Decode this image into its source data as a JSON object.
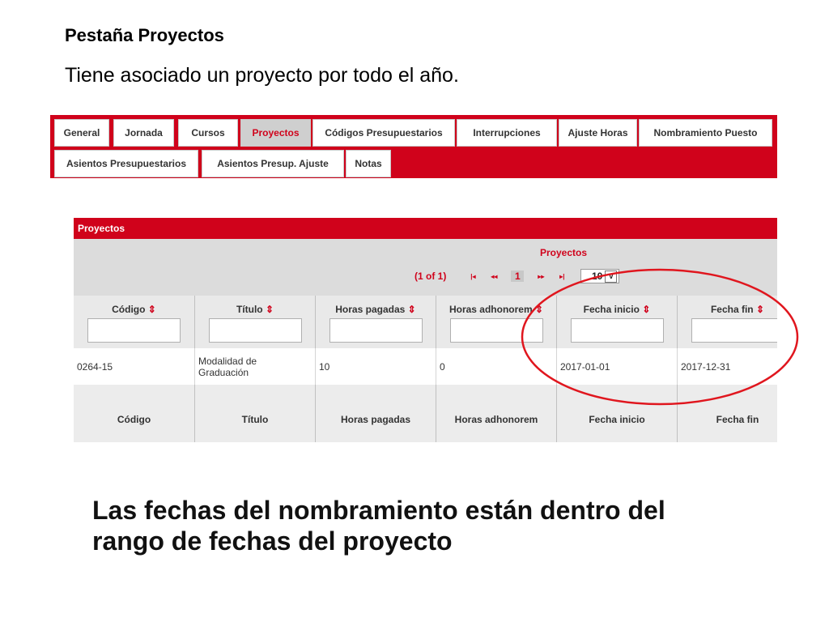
{
  "slide": {
    "heading": "Pestaña Proyectos",
    "intro": "Tiene asociado un proyecto por todo el año.",
    "conclusion": "Las fechas del nombramiento están dentro del rango de fechas del proyecto"
  },
  "tabs": {
    "general": "General",
    "jornada": "Jornada",
    "cursos": "Cursos",
    "proyectos": "Proyectos",
    "codigos": "Códigos Presupuestarios",
    "interrupciones": "Interrupciones",
    "ajuste_horas": "Ajuste Horas",
    "nombramiento": "Nombramiento Puesto",
    "asientos": "Asientos Presupuestarios",
    "asientos_ajuste": "Asientos Presup. Ajuste",
    "notas": "Notas",
    "active": "Proyectos"
  },
  "panel": {
    "title": "Proyectos",
    "caption": "Proyectos",
    "pager": {
      "count": "(1 of 1)",
      "first": "|◂",
      "prev": "◂◂",
      "current": "1",
      "next": "▸▸",
      "last": "▸|",
      "page_size": "10",
      "dropdown_arrow": "v"
    }
  },
  "sort_glyph": "⇕",
  "columns": {
    "codigo": "Código",
    "titulo": "Título",
    "horas_pagadas": "Horas pagadas",
    "horas_adhonorem": "Horas adhonorem",
    "fecha_inicio": "Fecha inicio",
    "fecha_fin": "Fecha fin"
  },
  "row": {
    "codigo": "0264-15",
    "titulo_line1": "Modalidad de",
    "titulo_line2": "Graduación",
    "horas_pagadas": "10",
    "horas_adhonorem": "0",
    "fecha_inicio": "2017-01-01",
    "fecha_fin": "2017-12-31"
  },
  "colors": {
    "accent_red": "#d0021b",
    "annotation_red": "#e0161e",
    "header_gray": "#dcdcdc"
  }
}
